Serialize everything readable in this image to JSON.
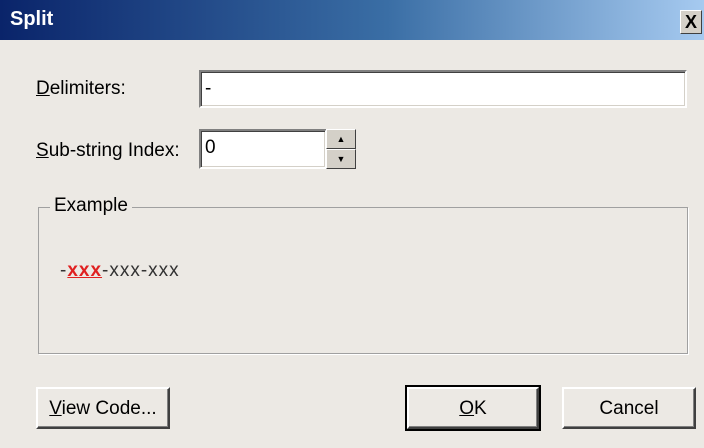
{
  "window": {
    "title": "Split",
    "close_label": "X"
  },
  "delimiters": {
    "mnemonic": "D",
    "label_rest": "elimiters:",
    "value": "-"
  },
  "substring": {
    "mnemonic": "S",
    "label_rest": "ub-string Index:",
    "value": "0"
  },
  "spinner": {
    "up_glyph": "▲",
    "down_glyph": "▼"
  },
  "example": {
    "group_label": "Example",
    "prefix": "-",
    "highlight": "xxx",
    "rest": "-xxx-xxx"
  },
  "buttons": {
    "view_code_mnemonic": "V",
    "view_code_rest": "iew Code...",
    "ok_mnemonic": "O",
    "ok_rest": "K",
    "cancel": "Cancel"
  }
}
